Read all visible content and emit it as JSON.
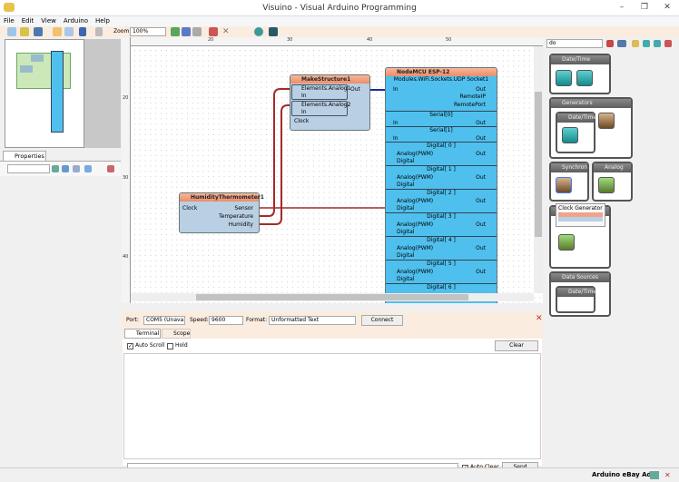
{
  "window": {
    "title": "Visuino - Visual Arduino Programming",
    "controls": [
      "–",
      "❐",
      "✕"
    ]
  },
  "menu": [
    "File",
    "Edit",
    "View",
    "Arduino",
    "Help"
  ],
  "toolbar": {
    "zoom_label": "Zoom:",
    "zoom_value": "100%"
  },
  "rulers": {
    "top": [
      "20",
      "30",
      "40",
      "50"
    ],
    "left": [
      "20",
      "30",
      "40"
    ]
  },
  "properties": {
    "tab": "Properties"
  },
  "components": {
    "humidity": {
      "title": "HumidityThermometer1",
      "pins_in": [
        "Clock"
      ],
      "pins_out": [
        "Sensor",
        "Temperature",
        "Humidity"
      ]
    },
    "make": {
      "title": "MakeStructure1",
      "el1": "Elements.Analog1",
      "el2": "Elements.Analog2",
      "in": "In",
      "clock": "Clock",
      "out": "Out"
    },
    "esp": {
      "title": "NodeMCU ESP-12",
      "udp": {
        "title": "Modules.WiFi.Sockets.UDP Socket1",
        "in": "In",
        "outs": [
          "Out",
          "RemoteIP",
          "RemotePort"
        ]
      },
      "serial": [
        {
          "title": "Serial[0]",
          "in": "In",
          "out": "Out"
        },
        {
          "title": "Serial[1]",
          "in": "In",
          "out": "Out"
        }
      ],
      "digital": [
        {
          "title": "Digital[ 0 ]",
          "a": "Analog(PWM)",
          "d": "Digital",
          "out": "Out"
        },
        {
          "title": "Digital[ 1 ]",
          "a": "Analog(PWM)",
          "d": "Digital",
          "out": "Out"
        },
        {
          "title": "Digital[ 2 ]",
          "a": "Analog(PWM)",
          "d": "Digital",
          "out": "Out"
        },
        {
          "title": "Digital[ 3 ]",
          "a": "Analog(PWM)",
          "d": "Digital",
          "out": "Out"
        },
        {
          "title": "Digital[ 4 ]",
          "a": "Analog(PWM)",
          "d": "Digital",
          "out": "Out"
        },
        {
          "title": "Digital[ 5 ]",
          "a": "Analog(PWM)",
          "d": "Digital",
          "out": "Out"
        },
        {
          "title": "Digital[ 6 ]",
          "a": "",
          "d": "",
          "out": ""
        }
      ]
    }
  },
  "palette": {
    "search": "do",
    "groups": [
      "Date/Time",
      "Generators",
      "Date/Time",
      "Synchron",
      "Analog",
      "Data Sources",
      "Date/Time"
    ],
    "tooltip": "Clock Generator"
  },
  "serial": {
    "port_label": "Port:",
    "port_value": "COM5 (Unava",
    "speed_label": "Speed:",
    "speed_value": "9600",
    "format_label": "Format:",
    "format_value": "Unformatted Text",
    "connect": "Connect",
    "tabs": [
      "Terminal",
      "Scope"
    ],
    "auto_scroll": "Auto Scroll",
    "hold": "Hold",
    "clear": "Clear",
    "auto_clear": "Auto Clear",
    "send": "Send"
  },
  "status": {
    "ads": "Arduino eBay Ads:"
  },
  "colors": {
    "wire": "#a32a2a",
    "wire_blue": "#1a2a9a",
    "header": "#ee8c69",
    "esp_body": "#4fc0ee",
    "comp_body": "#b9cfe4"
  }
}
